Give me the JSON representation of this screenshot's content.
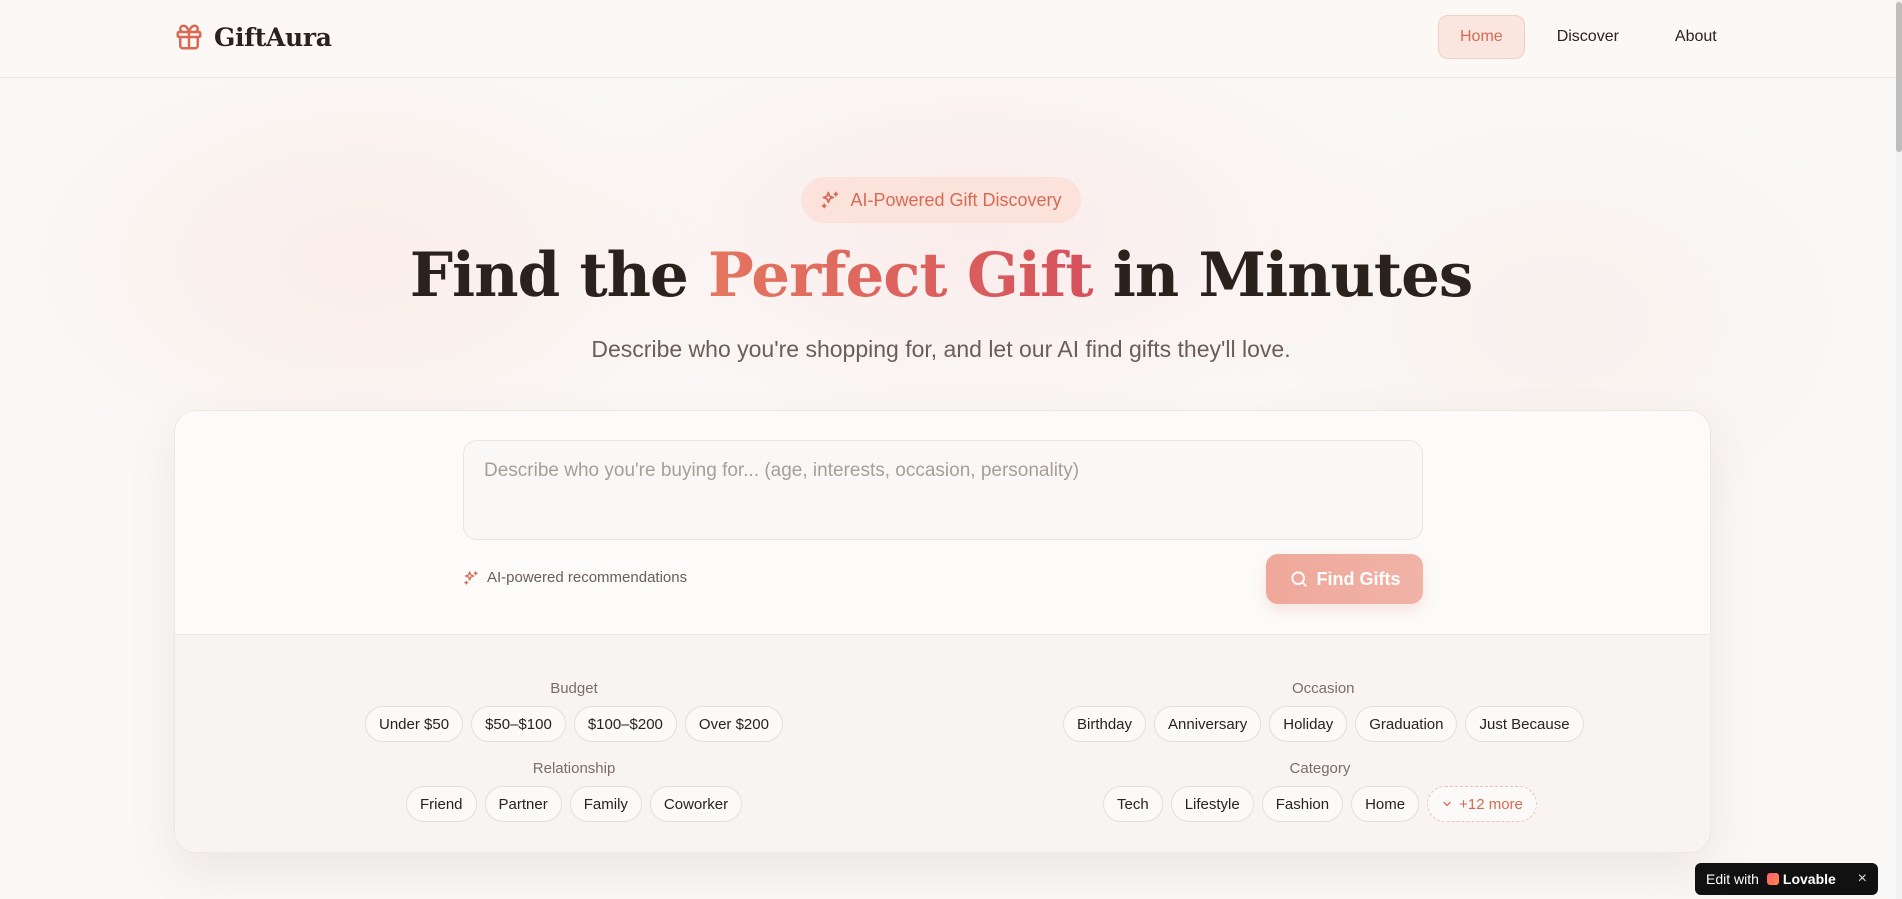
{
  "brand": {
    "name": "GiftAura",
    "icon": "gift-icon",
    "accent_color": "#d86a54"
  },
  "nav": {
    "items": [
      {
        "label": "Home",
        "active": true
      },
      {
        "label": "Discover",
        "active": false
      },
      {
        "label": "About",
        "active": false
      }
    ]
  },
  "hero": {
    "badge": "AI-Powered Gift Discovery",
    "headline_start": "Find the ",
    "headline_accent": "Perfect Gift",
    "headline_end": " in Minutes",
    "subhead": "Describe who you're shopping for, and let our AI find gifts they'll love."
  },
  "search": {
    "placeholder": "Describe who you're buying for... (age, interests, occasion, personality)",
    "value": "",
    "ai_note": "AI-powered recommendations",
    "button_label": "Find Gifts"
  },
  "filters": {
    "budget": {
      "label": "Budget",
      "options": [
        "Under $50",
        "$50–$100",
        "$100–$200",
        "Over $200"
      ]
    },
    "occasion": {
      "label": "Occasion",
      "options": [
        "Birthday",
        "Anniversary",
        "Holiday",
        "Graduation",
        "Just Because"
      ]
    },
    "relationship": {
      "label": "Relationship",
      "options": [
        "Friend",
        "Partner",
        "Family",
        "Coworker"
      ]
    },
    "category": {
      "label": "Category",
      "options": [
        "Tech",
        "Lifestyle",
        "Fashion",
        "Home"
      ],
      "more_label": "+12 more"
    }
  },
  "lovable_badge": {
    "prefix": "Edit with",
    "brand": "Lovable",
    "close": "×"
  }
}
